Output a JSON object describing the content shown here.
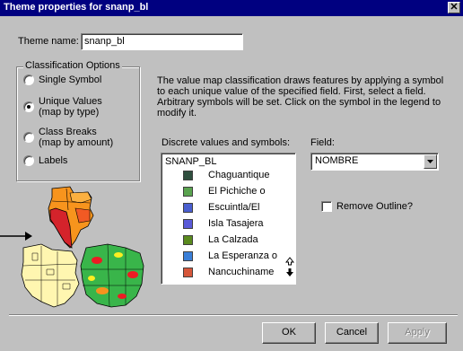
{
  "window": {
    "title": "Theme properties for snanp_bl",
    "close_glyph": "✕"
  },
  "theme_name": {
    "label": "Theme name:",
    "value": "snanp_bl"
  },
  "classification": {
    "legend": "Classification Options",
    "options": [
      {
        "label_lines": [
          "Single Symbol"
        ],
        "checked": false
      },
      {
        "label_lines": [
          "Unique Values",
          "(map by type)"
        ],
        "checked": true
      },
      {
        "label_lines": [
          "Class Breaks",
          "(map by amount)"
        ],
        "checked": false
      },
      {
        "label_lines": [
          "Labels"
        ],
        "checked": false
      }
    ]
  },
  "description": "The value map classification draws features by applying a symbol to each unique value of the specified field. First, select a field. Arbitrary symbols will be set. Click on the symbol in the legend to modify it.",
  "discrete": {
    "label": "Discrete values and symbols:",
    "header": "SNANP_BL",
    "items": [
      {
        "label": "Chaguantique",
        "color": "#2f4f3f"
      },
      {
        "label": "El Pichiche o",
        "color": "#5aa34f"
      },
      {
        "label": "Escuintla/El",
        "color": "#4a5fd0"
      },
      {
        "label": "Isla Tasajera",
        "color": "#5a5ad8"
      },
      {
        "label": "La Calzada",
        "color": "#5a8a1e"
      },
      {
        "label": "La Esperanza o",
        "color": "#3a7fd8"
      },
      {
        "label": "Nancuchiname",
        "color": "#d6573a"
      }
    ]
  },
  "field": {
    "label": "Field:",
    "value": "NOMBRE"
  },
  "remove_outline": {
    "label": "Remove Outline?",
    "checked": false
  },
  "buttons": {
    "ok": "OK",
    "cancel": "Cancel",
    "apply": "Apply"
  }
}
